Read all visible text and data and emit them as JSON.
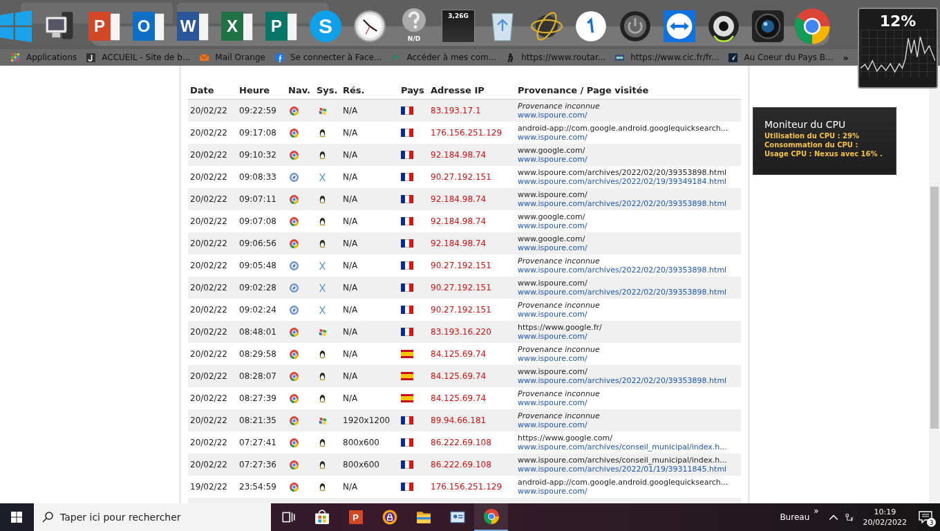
{
  "dock": [
    {
      "kind": "windows"
    },
    {
      "kind": "computer"
    },
    {
      "kind": "powerpoint",
      "letter": "P"
    },
    {
      "kind": "outlook",
      "letter": "O"
    },
    {
      "kind": "word",
      "letter": "W"
    },
    {
      "kind": "excel",
      "letter": "X"
    },
    {
      "kind": "publisher",
      "letter": "P"
    },
    {
      "kind": "skype",
      "letter": "S"
    },
    {
      "kind": "clock"
    },
    {
      "kind": "help",
      "label": "N/D"
    },
    {
      "kind": "memory",
      "label": "3,26G"
    },
    {
      "kind": "recycle"
    },
    {
      "kind": "globe"
    },
    {
      "kind": "pointer"
    },
    {
      "kind": "power"
    },
    {
      "kind": "arrows"
    },
    {
      "kind": "speaker"
    },
    {
      "kind": "camera"
    },
    {
      "kind": "chrome"
    }
  ],
  "bookmarks": [
    {
      "kind": "apps",
      "label": "Applications"
    },
    {
      "kind": "j",
      "label": "ACCUEIL - Site de b..."
    },
    {
      "kind": "mail",
      "label": "Mail Orange"
    },
    {
      "kind": "facebook",
      "label": "Se connecter à Face..."
    },
    {
      "kind": "bank",
      "label": "Accéder à mes com..."
    },
    {
      "kind": "hiker",
      "label": "https://www.routar..."
    },
    {
      "kind": "cic",
      "label": "https://www.cic.fr/fr..."
    },
    {
      "kind": "blog",
      "label": "Au Coeur du Pays B..."
    }
  ],
  "bookmarks_more": "»",
  "cpu_meter": {
    "reading": "12%"
  },
  "cpu_gadget": {
    "title": "Moniteur du CPU",
    "lines": [
      "Utilisation du CPU : 29%",
      "Consommation du CPU :",
      "Usage CPU : Nexus avec 16% ."
    ]
  },
  "table": {
    "columns": [
      "Date",
      "Heure",
      "Nav.",
      "Sys.",
      "Rés.",
      "Pays",
      "Adresse IP",
      "Provenance / Page visitée"
    ],
    "rows": [
      {
        "date": "20/02/22",
        "time": "09:22:59",
        "browser": {
          "kind": "chrome"
        },
        "system": {
          "kind": "windows"
        },
        "res": "N/A",
        "flag": {
          "kind": "fr"
        },
        "ip": "83.193.17.1",
        "source": {
          "kind": "unknown",
          "text": "Provenance inconnue"
        },
        "page": "www.ispoure.com/"
      },
      {
        "date": "20/02/22",
        "time": "09:17:08",
        "browser": {
          "kind": "chrome"
        },
        "system": {
          "kind": "linux"
        },
        "res": "N/A",
        "flag": {
          "kind": "fr"
        },
        "ip": "176.156.251.129",
        "source": {
          "kind": "url",
          "text": "android-app://com.google.android.googlequicksearch..."
        },
        "page": "www.ispoure.com/"
      },
      {
        "date": "20/02/22",
        "time": "09:10:32",
        "browser": {
          "kind": "chrome"
        },
        "system": {
          "kind": "linux"
        },
        "res": "N/A",
        "flag": {
          "kind": "fr"
        },
        "ip": "92.184.98.74",
        "source": {
          "kind": "url",
          "text": "www.google.com/"
        },
        "page": "www.ispoure.com/"
      },
      {
        "date": "20/02/22",
        "time": "09:08:33",
        "browser": {
          "kind": "safari"
        },
        "system": {
          "kind": "mac"
        },
        "res": "N/A",
        "flag": {
          "kind": "fr"
        },
        "ip": "90.27.192.151",
        "source": {
          "kind": "url",
          "text": "www.ispoure.com/archives/2022/02/20/39353898.html"
        },
        "page": "www.ispoure.com/archives/2022/02/19/39349184.html"
      },
      {
        "date": "20/02/22",
        "time": "09:07:11",
        "browser": {
          "kind": "chrome"
        },
        "system": {
          "kind": "linux"
        },
        "res": "N/A",
        "flag": {
          "kind": "fr"
        },
        "ip": "92.184.98.74",
        "source": {
          "kind": "url",
          "text": "www.ispoure.com/"
        },
        "page": "www.ispoure.com/archives/2022/02/20/39353898.html"
      },
      {
        "date": "20/02/22",
        "time": "09:07:08",
        "browser": {
          "kind": "chrome"
        },
        "system": {
          "kind": "linux"
        },
        "res": "N/A",
        "flag": {
          "kind": "fr"
        },
        "ip": "92.184.98.74",
        "source": {
          "kind": "url",
          "text": "www.google.com/"
        },
        "page": "www.ispoure.com/"
      },
      {
        "date": "20/02/22",
        "time": "09:06:56",
        "browser": {
          "kind": "chrome"
        },
        "system": {
          "kind": "linux"
        },
        "res": "N/A",
        "flag": {
          "kind": "fr"
        },
        "ip": "92.184.98.74",
        "source": {
          "kind": "url",
          "text": "www.google.com/"
        },
        "page": "www.ispoure.com/"
      },
      {
        "date": "20/02/22",
        "time": "09:05:48",
        "browser": {
          "kind": "safari"
        },
        "system": {
          "kind": "mac"
        },
        "res": "N/A",
        "flag": {
          "kind": "fr"
        },
        "ip": "90.27.192.151",
        "source": {
          "kind": "unknown",
          "text": "Provenance inconnue"
        },
        "page": "www.ispoure.com/archives/2022/02/20/39353898.html"
      },
      {
        "date": "20/02/22",
        "time": "09:02:28",
        "browser": {
          "kind": "safari"
        },
        "system": {
          "kind": "mac"
        },
        "res": "N/A",
        "flag": {
          "kind": "fr"
        },
        "ip": "90.27.192.151",
        "source": {
          "kind": "url",
          "text": "www.ispoure.com/"
        },
        "page": "www.ispoure.com/archives/2022/02/20/39353898.html"
      },
      {
        "date": "20/02/22",
        "time": "09:02:24",
        "browser": {
          "kind": "safari"
        },
        "system": {
          "kind": "mac"
        },
        "res": "N/A",
        "flag": {
          "kind": "fr"
        },
        "ip": "90.27.192.151",
        "source": {
          "kind": "unknown",
          "text": "Provenance inconnue"
        },
        "page": "www.ispoure.com/"
      },
      {
        "date": "20/02/22",
        "time": "08:48:01",
        "browser": {
          "kind": "chrome"
        },
        "system": {
          "kind": "windows"
        },
        "res": "N/A",
        "flag": {
          "kind": "fr"
        },
        "ip": "83.193.16.220",
        "source": {
          "kind": "url",
          "text": "https://www.google.fr/"
        },
        "page": "www.ispoure.com/"
      },
      {
        "date": "20/02/22",
        "time": "08:29:58",
        "browser": {
          "kind": "chrome"
        },
        "system": {
          "kind": "linux"
        },
        "res": "N/A",
        "flag": {
          "kind": "es"
        },
        "ip": "84.125.69.74",
        "source": {
          "kind": "unknown",
          "text": "Provenance inconnue"
        },
        "page": "www.ispoure.com/"
      },
      {
        "date": "20/02/22",
        "time": "08:28:07",
        "browser": {
          "kind": "chrome"
        },
        "system": {
          "kind": "linux"
        },
        "res": "N/A",
        "flag": {
          "kind": "es"
        },
        "ip": "84.125.69.74",
        "source": {
          "kind": "url",
          "text": "www.ispoure.com/"
        },
        "page": "www.ispoure.com/archives/2022/02/20/39353898.html"
      },
      {
        "date": "20/02/22",
        "time": "08:27:39",
        "browser": {
          "kind": "chrome"
        },
        "system": {
          "kind": "linux"
        },
        "res": "N/A",
        "flag": {
          "kind": "es"
        },
        "ip": "84.125.69.74",
        "source": {
          "kind": "unknown",
          "text": "Provenance inconnue"
        },
        "page": "www.ispoure.com/"
      },
      {
        "date": "20/02/22",
        "time": "08:21:35",
        "browser": {
          "kind": "chrome"
        },
        "system": {
          "kind": "windows"
        },
        "res": "1920x1200",
        "flag": {
          "kind": "fr"
        },
        "ip": "89.94.66.181",
        "source": {
          "kind": "unknown",
          "text": "Provenance inconnue"
        },
        "page": "www.ispoure.com/"
      },
      {
        "date": "20/02/22",
        "time": "07:27:41",
        "browser": {
          "kind": "chrome"
        },
        "system": {
          "kind": "linux"
        },
        "res": "800x600",
        "flag": {
          "kind": "fr"
        },
        "ip": "86.222.69.108",
        "source": {
          "kind": "url",
          "text": "https://www.google.com/"
        },
        "page": "www.ispoure.com/archives/conseil_municipal/index.h..."
      },
      {
        "date": "20/02/22",
        "time": "07:27:36",
        "browser": {
          "kind": "chrome"
        },
        "system": {
          "kind": "linux"
        },
        "res": "800x600",
        "flag": {
          "kind": "fr"
        },
        "ip": "86.222.69.108",
        "source": {
          "kind": "url",
          "text": "www.ispoure.com/archives/conseil_municipal/index.h..."
        },
        "page": "www.ispoure.com/archives/2022/01/19/39311845.html"
      },
      {
        "date": "19/02/22",
        "time": "23:54:59",
        "browser": {
          "kind": "chrome"
        },
        "system": {
          "kind": "linux"
        },
        "res": "N/A",
        "flag": {
          "kind": "fr"
        },
        "ip": "176.156.251.129",
        "source": {
          "kind": "url",
          "text": "android-app://com.google.android.googlequicksearch..."
        },
        "page": "www.ispoure.com/"
      }
    ]
  },
  "taskbar": {
    "search_placeholder": "Taper ici pour rechercher",
    "apps": [
      {
        "kind": "taskview",
        "selected": false
      },
      {
        "kind": "store",
        "selected": false
      },
      {
        "kind": "powerpoint",
        "letter": "P",
        "selected": false
      },
      {
        "kind": "shield",
        "selected": false
      },
      {
        "kind": "folder",
        "selected": false
      },
      {
        "kind": "contacts",
        "selected": false
      },
      {
        "kind": "chrome",
        "selected": true
      }
    ],
    "desktop_label": "Bureau",
    "more": "»",
    "time": "10:19",
    "date": "20/02/2022",
    "notifications": "3"
  }
}
